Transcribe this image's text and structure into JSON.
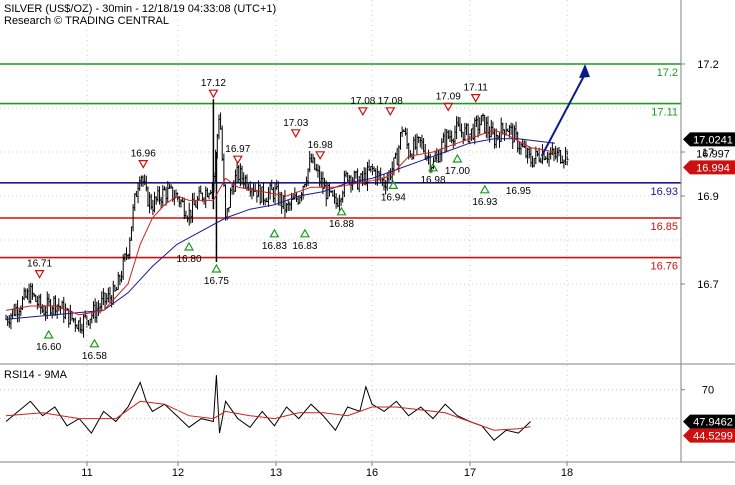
{
  "header": {
    "title": "SILVER (US$/OZ) - 30min - 12/18/19 04:33:08 (UTC+1)",
    "subtitle": "Research © TRADING CENTRAL"
  },
  "rsi_label": "RSI14 - 9MA",
  "colors": {
    "price": "#000000",
    "ma_fast": "#d02020",
    "ma_slow": "#1a1a8c",
    "resistance": "#1f9a1f",
    "pivot": "#1a1a8c",
    "support": "#cc1010",
    "arrow": "#0c1a8a",
    "grid": "#c8c8c8",
    "label_box_black": "#000000",
    "label_box_red": "#cc1010"
  },
  "chart_data": [
    {
      "type": "line",
      "panel": "price",
      "y_ticks": [
        "17.2",
        "17",
        "16.9",
        "16.7"
      ],
      "ylim": [
        16.52,
        17.22
      ],
      "x_ticks": [
        "11",
        "12",
        "13",
        "16",
        "17",
        "18"
      ],
      "xlim": [
        0,
        100
      ],
      "levels": [
        {
          "label": "17.2",
          "value": 17.2,
          "kind": "resistance"
        },
        {
          "label": "17.11",
          "value": 17.11,
          "kind": "resistance"
        },
        {
          "label": "16.93",
          "value": 16.93,
          "kind": "pivot"
        },
        {
          "label": "16.85",
          "value": 16.85,
          "kind": "support"
        },
        {
          "label": "16.76",
          "value": 16.76,
          "kind": "support"
        }
      ],
      "current_labels": [
        {
          "label": "17.0241",
          "value": 17.0241,
          "style": "box-black"
        },
        {
          "label": "16.997",
          "value": 16.997,
          "style": "plain"
        },
        {
          "label": "16.994",
          "value": 16.994,
          "style": "box-red"
        }
      ],
      "close_series": {
        "x": [
          0,
          2,
          4,
          6,
          8,
          10,
          12,
          14,
          16,
          18,
          20,
          21,
          22,
          23,
          24,
          26,
          28,
          30,
          32,
          34,
          35,
          36,
          37,
          38,
          40,
          42,
          44,
          46,
          48,
          50,
          52,
          54,
          56,
          58,
          60,
          62,
          64,
          65,
          66,
          68,
          70,
          72,
          74,
          76,
          78,
          80,
          82,
          84,
          86,
          88,
          90,
          92
        ],
        "y": [
          16.62,
          16.65,
          16.68,
          16.64,
          16.66,
          16.63,
          16.61,
          16.63,
          16.66,
          16.68,
          16.78,
          16.88,
          16.96,
          16.9,
          16.88,
          16.91,
          16.9,
          16.86,
          16.9,
          16.93,
          17.1,
          16.84,
          16.92,
          16.95,
          16.93,
          16.9,
          16.91,
          16.87,
          16.9,
          16.98,
          16.92,
          16.88,
          16.95,
          16.93,
          16.96,
          16.93,
          16.98,
          17.06,
          17.0,
          17.02,
          16.97,
          17.03,
          17.05,
          17.04,
          17.07,
          17.03,
          17.06,
          17.02,
          16.98,
          17.0,
          16.99,
          16.997
        ]
      },
      "ma_fast": {
        "x": [
          0,
          4,
          8,
          12,
          16,
          20,
          22,
          24,
          26,
          28,
          30,
          34,
          36,
          38,
          42,
          46,
          50,
          54,
          58,
          62,
          64,
          66,
          70,
          74,
          78,
          80,
          82,
          86,
          90
        ],
        "y": [
          16.64,
          16.65,
          16.65,
          16.63,
          16.64,
          16.7,
          16.79,
          16.85,
          16.88,
          16.9,
          16.89,
          16.89,
          16.94,
          16.92,
          16.91,
          16.9,
          16.92,
          16.92,
          16.93,
          16.94,
          16.96,
          16.99,
          17.0,
          17.02,
          17.04,
          17.05,
          17.04,
          17.01,
          17.0
        ]
      },
      "ma_slow": {
        "x": [
          0,
          8,
          16,
          20,
          24,
          28,
          32,
          36,
          40,
          44,
          48,
          52,
          56,
          60,
          64,
          68,
          72,
          76,
          80,
          84,
          90
        ],
        "y": [
          16.62,
          16.63,
          16.64,
          16.68,
          16.74,
          16.79,
          16.82,
          16.85,
          16.87,
          16.88,
          16.9,
          16.91,
          16.93,
          16.94,
          16.96,
          16.98,
          17.0,
          17.02,
          17.03,
          17.03,
          17.02
        ]
      },
      "annotations": [
        {
          "label": "16.71",
          "x": 5.5,
          "value": 16.71,
          "marker": "down"
        },
        {
          "label": "16.60",
          "x": 7,
          "value": 16.6,
          "marker": "up"
        },
        {
          "label": "16.58",
          "x": 14.5,
          "value": 16.58,
          "marker": "up"
        },
        {
          "label": "16.96",
          "x": 22.5,
          "value": 16.96,
          "marker": "down"
        },
        {
          "label": "16.80",
          "x": 30,
          "value": 16.8,
          "marker": "up"
        },
        {
          "label": "17.12",
          "x": 34,
          "value": 17.12,
          "marker": "down"
        },
        {
          "label": "16.75",
          "x": 34.5,
          "value": 16.75,
          "marker": "up"
        },
        {
          "label": "16.97",
          "x": 38,
          "value": 16.97,
          "marker": "down"
        },
        {
          "label": "16.83",
          "x": 44,
          "value": 16.83,
          "marker": "up"
        },
        {
          "label": "17.03",
          "x": 47.5,
          "value": 17.03,
          "marker": "down"
        },
        {
          "label": "16.83",
          "x": 49,
          "value": 16.83,
          "marker": "up"
        },
        {
          "label": "16.98",
          "x": 51.5,
          "value": 16.98,
          "marker": "down"
        },
        {
          "label": "16.88",
          "x": 55,
          "value": 16.88,
          "marker": "up"
        },
        {
          "label": "17.08",
          "x": 58.5,
          "value": 17.08,
          "marker": "down"
        },
        {
          "label": "17.08",
          "x": 63,
          "value": 17.08,
          "marker": "down"
        },
        {
          "label": "16.94",
          "x": 63.5,
          "value": 16.94,
          "marker": "up"
        },
        {
          "label": "16.98",
          "x": 70,
          "value": 16.98,
          "marker": "up"
        },
        {
          "label": "17.09",
          "x": 72.5,
          "value": 17.09,
          "marker": "down"
        },
        {
          "label": "17.00",
          "x": 74,
          "value": 17.0,
          "marker": "up"
        },
        {
          "label": "17.11",
          "x": 77,
          "value": 17.11,
          "marker": "down"
        },
        {
          "label": "16.93",
          "x": 78.5,
          "value": 16.93,
          "marker": "up"
        },
        {
          "label": "16.95",
          "x": 84,
          "value": 16.95,
          "marker": "none"
        }
      ],
      "projection_arrow": {
        "x": [
          87,
          90
        ],
        "y": [
          17.0,
          17.2
        ]
      }
    },
    {
      "type": "line",
      "panel": "rsi",
      "y_ticks": [
        "70"
      ],
      "ylim": [
        20,
        85
      ],
      "rsi_labels": [
        {
          "label": "47.9462",
          "value": 47.9462,
          "style": "box-black"
        },
        {
          "label": "44.5299",
          "value": 44.5299,
          "style": "box-red"
        }
      ],
      "rsi": {
        "x": [
          0,
          2,
          4,
          6,
          8,
          10,
          12,
          14,
          16,
          18,
          20,
          22,
          23,
          24,
          26,
          28,
          30,
          32,
          34,
          34.5,
          35,
          36,
          38,
          40,
          42,
          44,
          46,
          48,
          50,
          52,
          54,
          56,
          58,
          59,
          60,
          62,
          64,
          66,
          68,
          70,
          72,
          74,
          76,
          78,
          80,
          82,
          84,
          86
        ],
        "y": [
          48,
          55,
          62,
          52,
          58,
          45,
          50,
          40,
          55,
          48,
          58,
          75,
          62,
          55,
          60,
          52,
          44,
          50,
          48,
          80,
          40,
          62,
          50,
          44,
          55,
          45,
          58,
          50,
          60,
          52,
          42,
          58,
          55,
          72,
          60,
          55,
          62,
          52,
          58,
          50,
          60,
          52,
          48,
          45,
          35,
          42,
          40,
          48
        ]
      },
      "rsi_ma": {
        "x": [
          0,
          6,
          12,
          18,
          22,
          26,
          30,
          34,
          36,
          40,
          44,
          48,
          52,
          56,
          60,
          64,
          68,
          72,
          76,
          80,
          84,
          86
        ],
        "y": [
          52,
          54,
          50,
          50,
          62,
          60,
          52,
          50,
          55,
          52,
          50,
          54,
          54,
          52,
          58,
          58,
          56,
          54,
          48,
          42,
          43,
          44.5
        ]
      }
    }
  ]
}
